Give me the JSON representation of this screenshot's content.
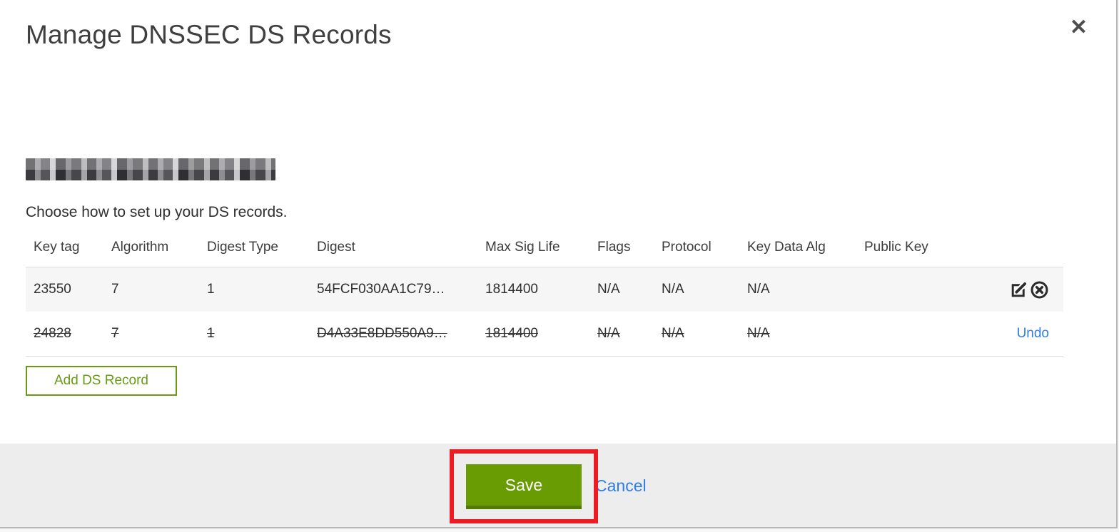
{
  "modal": {
    "title": "Manage DNSSEC DS Records",
    "close_icon": "✕",
    "domain_redacted": true,
    "instruction": "Choose how to set up your DS records."
  },
  "table": {
    "columns": [
      "Key tag",
      "Algorithm",
      "Digest Type",
      "Digest",
      "Max Sig Life",
      "Flags",
      "Protocol",
      "Key Data Alg",
      "Public Key"
    ],
    "rows": [
      {
        "key_tag": "23550",
        "algorithm": "7",
        "digest_type": "1",
        "digest": "54FCF030AA1C79…",
        "max_sig_life": "1814400",
        "flags": "N/A",
        "protocol": "N/A",
        "key_data_alg": "N/A",
        "public_key": "",
        "state": "normal",
        "actions": [
          "edit",
          "delete"
        ]
      },
      {
        "key_tag": "24828",
        "algorithm": "7",
        "digest_type": "1",
        "digest": "D4A33E8DD550A9…",
        "max_sig_life": "1814400",
        "flags": "N/A",
        "protocol": "N/A",
        "key_data_alg": "N/A",
        "public_key": "",
        "state": "deleted",
        "undo_label": "Undo"
      }
    ]
  },
  "buttons": {
    "add_ds_record": "Add DS Record",
    "save": "Save",
    "cancel": "Cancel"
  },
  "colors": {
    "save_green": "#699c02",
    "add_button_green": "#689b12",
    "link_blue": "#2e7de9",
    "annotation_red": "#ec1c24",
    "footer_gray": "#ededed",
    "row_highlight_gray": "#f6f6f6"
  }
}
